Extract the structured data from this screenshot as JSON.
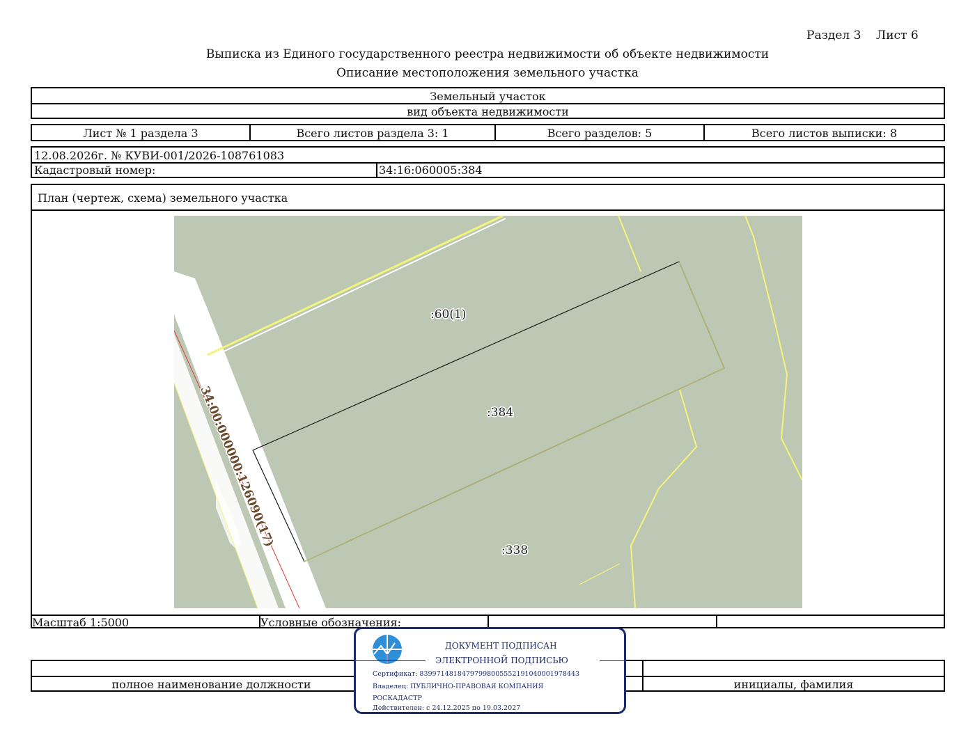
{
  "header": {
    "section_sheet": "Раздел 3    Лист 6",
    "title": "Выписка из Единого государственного реестра недвижимости об объекте недвижимости",
    "subtitle": "Описание местоположения земельного участка"
  },
  "object": {
    "name": "Земельный участок",
    "kind_caption": "вид объекта недвижимости"
  },
  "sheets": {
    "sheet": "Лист № 1 раздела 3",
    "total_section_sheets": "Всего листов раздела 3: 1",
    "total_sections": "Всего разделов: 5",
    "total_extract_sheets": "Всего листов выписки: 8"
  },
  "record": {
    "date_number": "12.08.2026г. № КУВИ-001/2026-108761083",
    "cadastral_label": "Кадастровый номер:",
    "cadastral_value": "34:16:060005:384"
  },
  "plan": {
    "title": "План (чертеж, схема) земельного участка",
    "labels": {
      "parcel_60": ":60(1)",
      "parcel_384": ":384",
      "parcel_338": ":338",
      "road": "34:00:000000:126090(17)"
    },
    "colors": {
      "background": "#bcc8b4",
      "boundary": "#f4f47a",
      "road": "#ffffff",
      "redline": "#e03a3a"
    }
  },
  "legend": {
    "scale": "Масштаб 1:5000",
    "conventions": "Условные обозначения:"
  },
  "signature": {
    "position_caption": "полное наименование должности",
    "initials_caption": "инициалы, фамилия"
  },
  "stamp": {
    "line1": "ДОКУМЕНТ ПОДПИСАН",
    "line2": "ЭЛЕКТРОННОЙ ПОДПИСЬЮ",
    "certificate": "Сертификат: 83997148184797998005552191040001978443",
    "owner": "Владелец: ПУБЛИЧНО-ПРАВОВАЯ КОМПАНИЯ",
    "owner2": "РОСКАДАСТР",
    "valid": "Действителен: с 24.12.2025 по 19.03.2027",
    "color": "#1b2a6b",
    "logo_color": "#2e8fd8"
  }
}
